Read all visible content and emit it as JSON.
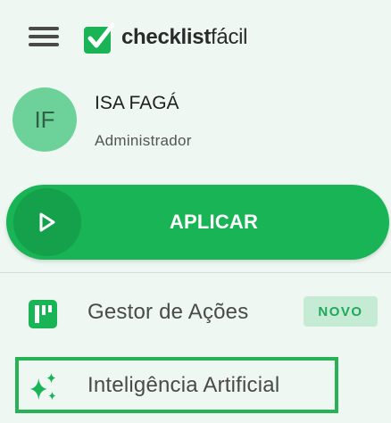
{
  "header": {
    "logo": {
      "bold": "checklist",
      "light": "fácil"
    }
  },
  "user": {
    "initials": "IF",
    "name": "ISA FAGÁ",
    "role": "Administrador"
  },
  "apply_button": {
    "label": "APLICAR"
  },
  "menu": {
    "items": [
      {
        "label": "Gestor de Ações",
        "badge": "NOVO",
        "icon": "kanban-board-icon"
      },
      {
        "label": "Inteligência Artificial",
        "icon": "sparkles-icon"
      }
    ]
  },
  "colors": {
    "background": "#eef7f1",
    "brand_green": "#18b456",
    "avatar_bg": "#6dd29a",
    "badge_bg": "#c6ebd5",
    "badge_text": "#1ea85a",
    "highlight_border": "#28b256"
  }
}
